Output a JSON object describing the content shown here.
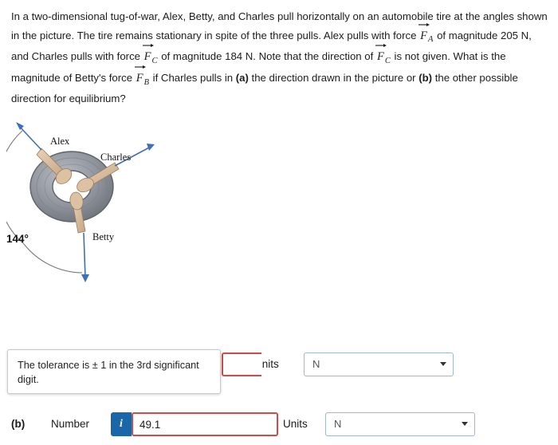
{
  "question": {
    "p1_a": "In a two-dimensional tug-of-war, Alex, Betty, and Charles pull horizontally on an automobile tire at the angles shown in the picture. The tire remains stationary in spite of the three pulls. Alex pulls with force ",
    "vec_F": "F",
    "sub_A": "A",
    "p1_b": " of magnitude 205 N, and Charles pulls with force ",
    "sub_C": "C",
    "p1_c": " of magnitude 184 N. Note that the direction of ",
    "sub_C2": "C",
    "p1_d": " is not given. What is the magnitude of Betty's force ",
    "sub_B": "B",
    "p1_e": " if Charles pulls in ",
    "bold_a": "(a)",
    "p1_f": " the direction drawn in the picture or ",
    "bold_b": "(b)",
    "p1_g": " the other possible direction for equilibrium?"
  },
  "figure": {
    "label_alex": "Alex",
    "label_charles": "Charles",
    "label_betty": "Betty",
    "angle": "144°"
  },
  "tooltip": {
    "text": "The tolerance is ± 1 in the 3rd significant digit."
  },
  "answers": {
    "part_b_label": "(b)",
    "number_label": "Number",
    "info_icon": "i",
    "value_b": "49.1",
    "units_label_a": "Units",
    "units_label_b": "Units",
    "units_value_a": "N",
    "units_value_b": "N"
  },
  "colors": {
    "info_badge": "#1a66a8",
    "error_border": "#d04a48",
    "select_border": "#9fb8cf",
    "arrow_blue": "#3f6fb5"
  }
}
